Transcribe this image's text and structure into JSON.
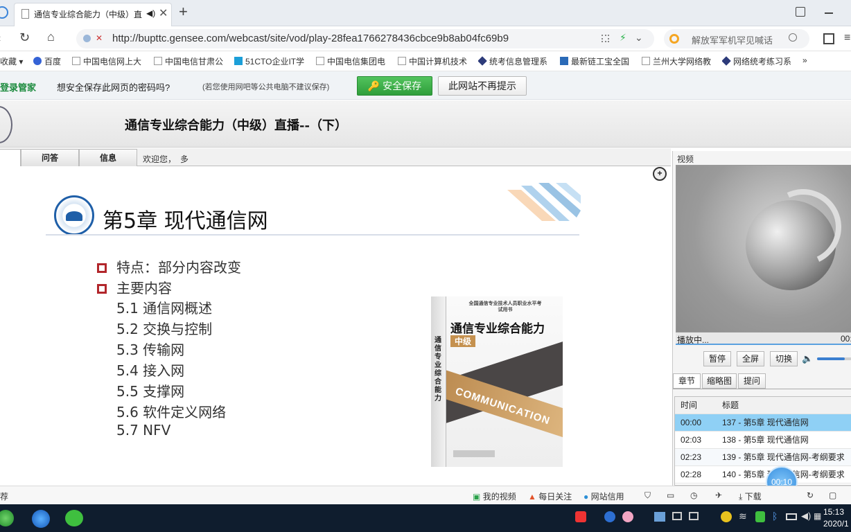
{
  "browser": {
    "tab_title": "通信专业综合能力（中级）直",
    "new_tab_symbol": "+",
    "url": "http://bupttc.gensee.com/webcast/site/vod/play-28fea1766278436cbce9b8ab04fc69b9",
    "search_placeholder": "解放军军机罕见喊话",
    "bookmarks": [
      {
        "label": "收藏"
      },
      {
        "label": "百度"
      },
      {
        "label": "中国电信网上大"
      },
      {
        "label": "中国电信甘肃公"
      },
      {
        "label": "51CTO企业IT学"
      },
      {
        "label": "中国电信集团电"
      },
      {
        "label": "中国计算机技术"
      },
      {
        "label": "统考信息管理系"
      },
      {
        "label": "最新链工宝全国"
      },
      {
        "label": "兰州大学网络教"
      },
      {
        "label": "网络统考练习系"
      }
    ],
    "more_symbol": "»"
  },
  "password_bar": {
    "brand": "登录管家",
    "prompt": "想安全保存此网页的密码吗?",
    "hint": "(若您使用网吧等公共电脑不建议保存)",
    "save_label": "安全保存",
    "never_label": "此网站不再提示"
  },
  "page": {
    "title": "通信专业综合能力（中级）直播--（下）",
    "tabs": [
      {
        "label": "问答"
      },
      {
        "label": "信息"
      }
    ],
    "welcome": "欢迎您，",
    "welcome_user": "多"
  },
  "slide": {
    "chapter_title": "第5章 现代通信网",
    "bullets": [
      "特点：部分内容改变",
      "主要内容"
    ],
    "toc": [
      "5.1 通信网概述",
      "5.2 交换与控制",
      "5.3 传输网",
      "5.4 接入网",
      "5.5 支撑网",
      "5.6 软件定义网络",
      "5.7 NFV"
    ],
    "book": {
      "series": "全国通信专业技术人员职业水平考试用书",
      "title": "通信专业综合能力",
      "level": "中级",
      "banner": "COMMUNICATION",
      "spine": "通信专业综合能力"
    }
  },
  "player": {
    "section_label": "视频",
    "status": "播放中...",
    "status_time": "00:",
    "buttons": [
      "暂停",
      "全屏",
      "切换"
    ],
    "volume_level": 0.8,
    "tabs": [
      "章节",
      "缩略图",
      "提问"
    ],
    "table_headers": [
      "时间",
      "标题"
    ],
    "chapters": [
      {
        "time": "00:00",
        "title": "137 - 第5章 现代通信网",
        "selected": true
      },
      {
        "time": "02:03",
        "title": "138 - 第5章 现代通信网",
        "selected": false
      },
      {
        "time": "02:23",
        "title": "139 - 第5章 现代通信网-考纲要求",
        "selected": false
      },
      {
        "time": "02:28",
        "title": "140 - 第5章 现代通信网-考纲要求",
        "selected": false
      }
    ],
    "float_timer": "00:10"
  },
  "statusbar": {
    "left": "荐",
    "my_video": "我的视频",
    "daily": "每日关注",
    "credit": "网站信用",
    "download": "下载"
  },
  "taskbar": {
    "time": "15:13",
    "date": "2020/1"
  },
  "colors": {
    "accent_green": "#3db54a",
    "selected_row": "#8fd0f5",
    "bullet_red": "#b2262b",
    "taskbar": "#0f1d2e"
  }
}
